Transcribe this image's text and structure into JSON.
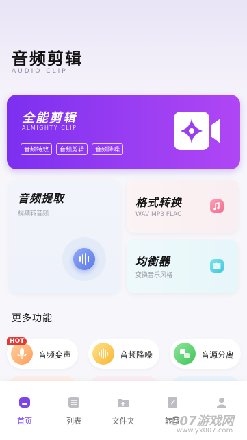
{
  "header": {
    "title": "音频剪辑",
    "subtitle": "AUDIO CLIP"
  },
  "hero": {
    "title": "全能剪辑",
    "subtitle": "ALMIGHTY CLIP",
    "tags": [
      "音频特效",
      "音频剪辑",
      "音频降噪"
    ],
    "icon": "video-clip-icon"
  },
  "cards": {
    "extract": {
      "title": "音频提取",
      "desc": "视频转音频",
      "icon": "audio-wave-icon"
    },
    "format": {
      "title": "格式转换",
      "desc": "WAV   MP3   FLAC",
      "icon": "music-note-icon"
    },
    "equalizer": {
      "title": "均衡器",
      "desc": "变换音乐风格",
      "icon": "sliders-icon"
    }
  },
  "more": {
    "title": "更多功能",
    "items": [
      {
        "label": "音频变声",
        "icon": "microphone-icon",
        "badge": "HOT"
      },
      {
        "label": "音频降噪",
        "icon": "waveform-icon"
      },
      {
        "label": "音源分离",
        "icon": "split-icon"
      }
    ]
  },
  "tabbar": {
    "items": [
      {
        "label": "首页",
        "icon": "home-icon",
        "active": true
      },
      {
        "label": "列表",
        "icon": "list-icon"
      },
      {
        "label": "文件夹",
        "icon": "folder-add-icon"
      },
      {
        "label": "转写",
        "icon": "edit-icon"
      },
      {
        "label": "",
        "icon": "user-icon"
      }
    ]
  },
  "watermark": {
    "text": "007游戏网",
    "url": "www.yx007.com"
  },
  "colors": {
    "accent": "#7b45e8",
    "hero_start": "#7c2ff0",
    "hero_end": "#b046f5",
    "hot": "#e53935"
  }
}
